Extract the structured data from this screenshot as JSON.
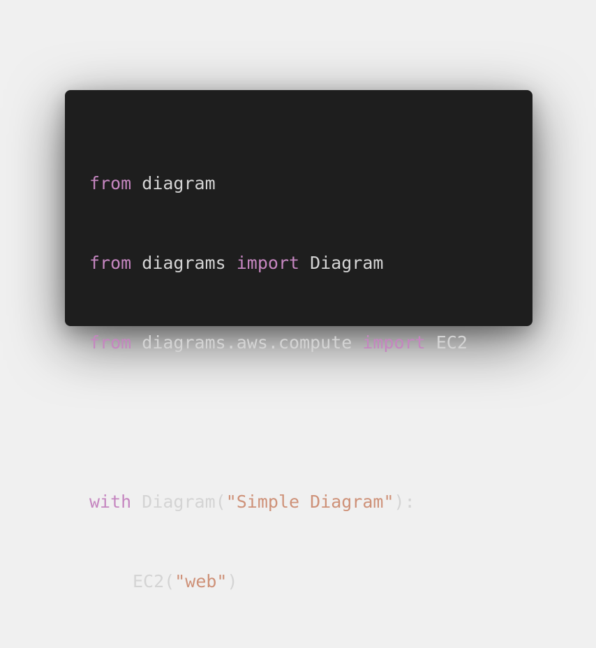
{
  "code": {
    "lines": [
      {
        "kw1": "from",
        "t1": " diagram"
      },
      {
        "kw1": "from",
        "t1": " diagrams ",
        "kw2": "import",
        "t2": " Diagram"
      },
      {
        "kw1": "from",
        "t1": " diagrams.aws.compute ",
        "kw2": "import",
        "t2": " EC2"
      },
      {},
      {
        "kw1": "with",
        "t1": " Diagram(",
        "s1": "\"Simple Diagram\"",
        "t2": "):"
      },
      {
        "t1": "EC2(",
        "s1": "\"web\"",
        "t2": ")"
      }
    ]
  },
  "colors": {
    "background": "#f0f0f0",
    "card": "#1e1e1e",
    "keyword": "#c586c0",
    "plain": "#d4d4d4",
    "string": "#ce9178"
  }
}
